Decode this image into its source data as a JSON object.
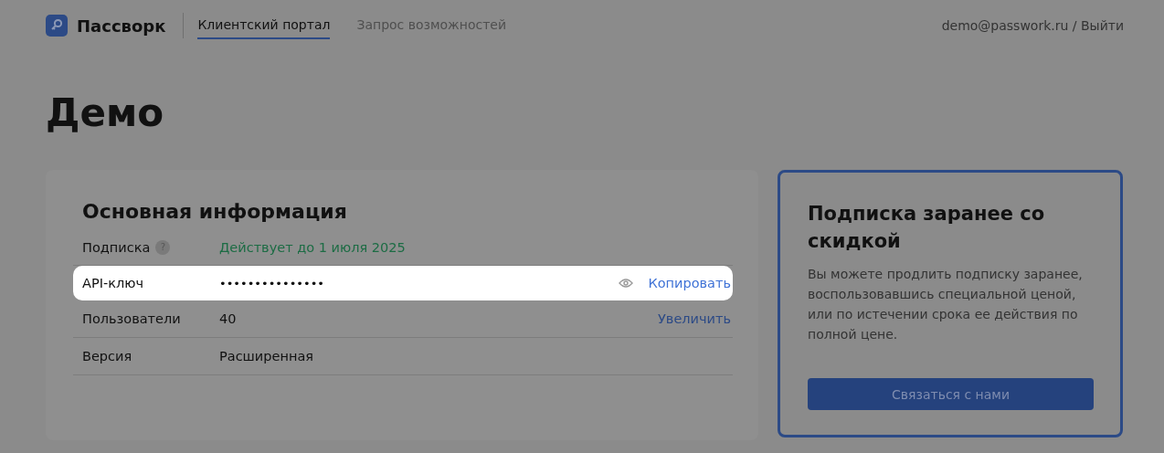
{
  "header": {
    "logo": "Пассворк",
    "tabs": [
      {
        "label": "Клиентский портал",
        "selected": true
      },
      {
        "label": "Запрос возможностей",
        "selected": false
      }
    ],
    "user": "demo@passwork.ru / Выйти"
  },
  "title": "Демо",
  "info": {
    "heading": "Основная информация",
    "rows": [
      {
        "label": "Подписка",
        "help": "?",
        "kind": "status",
        "value": "Действует до 1 июля 2025",
        "highlighted": false
      },
      {
        "label": "API-ключ",
        "kind": "secret",
        "value": "•••••••••••••••",
        "action": "Копировать",
        "highlighted": true
      },
      {
        "label": "Пользователи",
        "kind": "plain",
        "value": "40",
        "action": "Увеличить",
        "highlighted": false
      },
      {
        "label": "Версия",
        "kind": "plain",
        "value": "Расширенная",
        "highlighted": false
      }
    ]
  },
  "promo": {
    "heading": "Подписка заранее со скидкой",
    "text": "Вы можете продлить подписку заранее, воспользовавшись специальной ценой, или по истечении срока ее действия по полной цене.",
    "button": "Связаться с нами"
  }
}
